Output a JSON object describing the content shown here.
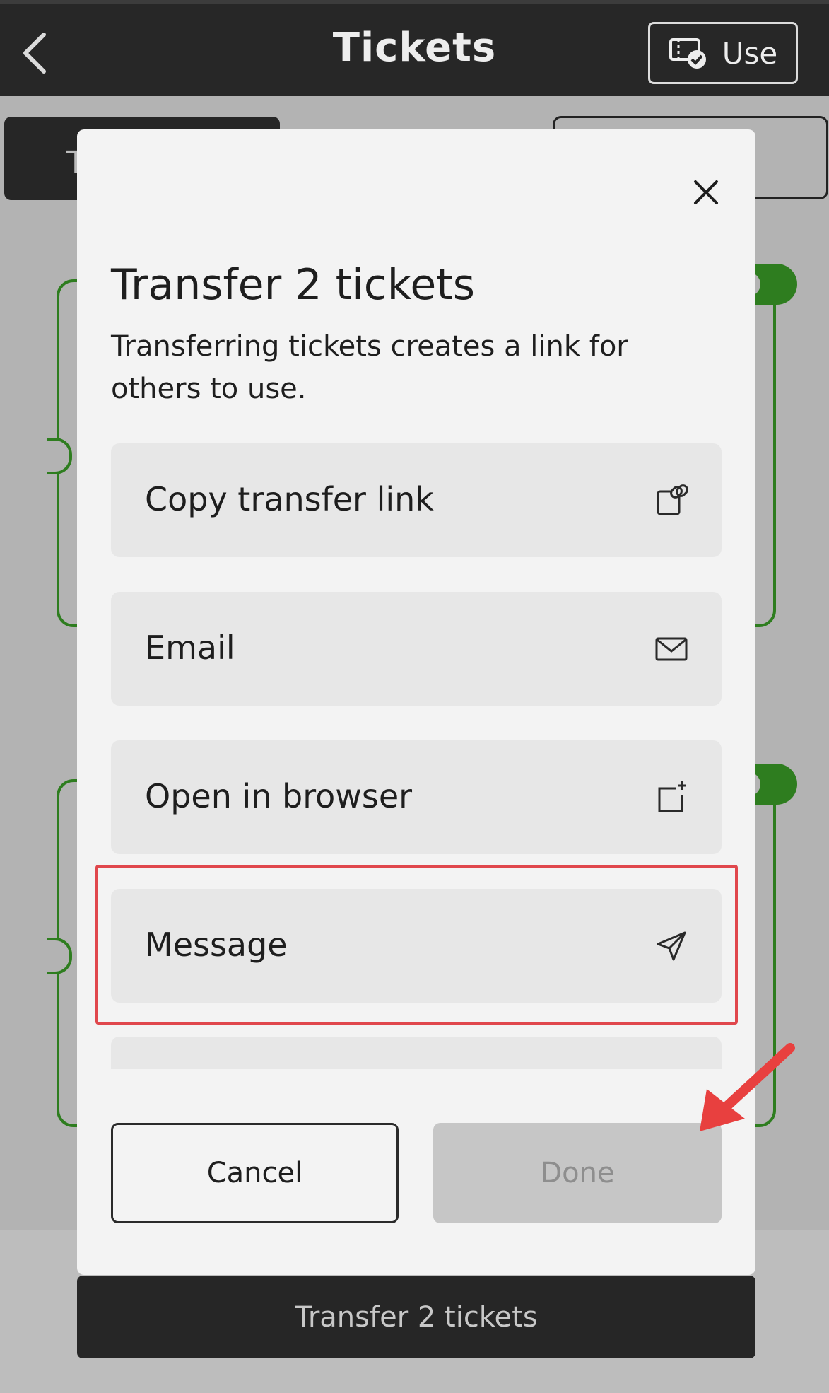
{
  "header": {
    "title": "Tickets",
    "use_label": "Use"
  },
  "background": {
    "tab_left_label": "T",
    "transfer_button": "Transfer 2 tickets"
  },
  "modal": {
    "title": "Transfer 2 tickets",
    "description": "Transferring tickets creates a link for others to use.",
    "options": [
      {
        "label": "Copy transfer link",
        "icon": "copy-link-icon"
      },
      {
        "label": "Email",
        "icon": "mail-icon"
      },
      {
        "label": "Open in browser",
        "icon": "open-external-icon"
      },
      {
        "label": "Message",
        "icon": "send-icon"
      }
    ],
    "cancel_label": "Cancel",
    "done_label": "Done"
  },
  "colors": {
    "topbar": "#272727",
    "accent_green": "#2e7d1f",
    "highlight_red": "#e0474c"
  }
}
